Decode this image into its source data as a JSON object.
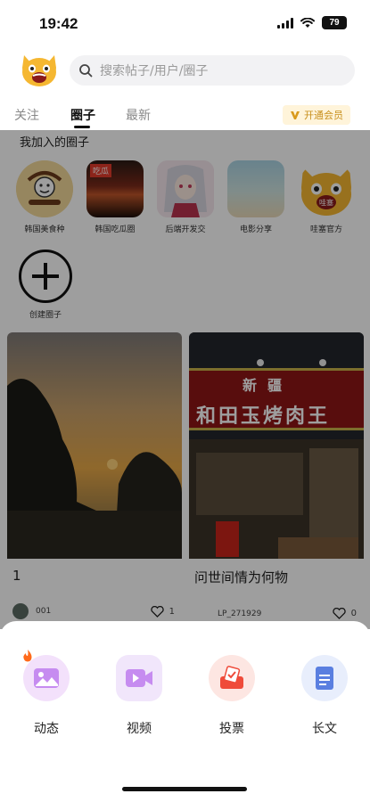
{
  "status": {
    "time": "19:42",
    "battery": "79"
  },
  "search": {
    "placeholder": "搜索帖子/用户/圈子"
  },
  "tabs": [
    {
      "label": "关注"
    },
    {
      "label": "圈子",
      "active": true
    },
    {
      "label": "最新"
    }
  ],
  "vip": {
    "label": "开通会员"
  },
  "joined": {
    "title": "我加入的圈子",
    "circles": [
      {
        "name": "韩国美食种"
      },
      {
        "name": "韩国吃瓜圈",
        "thumb_text": "吃瓜"
      },
      {
        "name": "后端开发交"
      },
      {
        "name": "电影分享"
      },
      {
        "name": "哇塞官方",
        "thumb_text": "哇塞"
      }
    ],
    "create_label": "创建圈子"
  },
  "posts": [
    {
      "title": "1",
      "user": "001",
      "likes": "1"
    },
    {
      "title": "问世间情为何物",
      "user": "LP_271929",
      "likes": "0",
      "sign_text": "和田玉烤肉王",
      "sign_text_top": "新疆"
    }
  ],
  "post_options": [
    {
      "label": "动态",
      "icon": "image-icon"
    },
    {
      "label": "视频",
      "icon": "video-icon"
    },
    {
      "label": "投票",
      "icon": "vote-icon"
    },
    {
      "label": "长文",
      "icon": "article-icon"
    }
  ],
  "colors": {
    "accent_purple": "#c68cf0",
    "vip_gold": "#c8901d",
    "vote_red": "#ef4b3a",
    "article_blue": "#5a7fe0"
  }
}
